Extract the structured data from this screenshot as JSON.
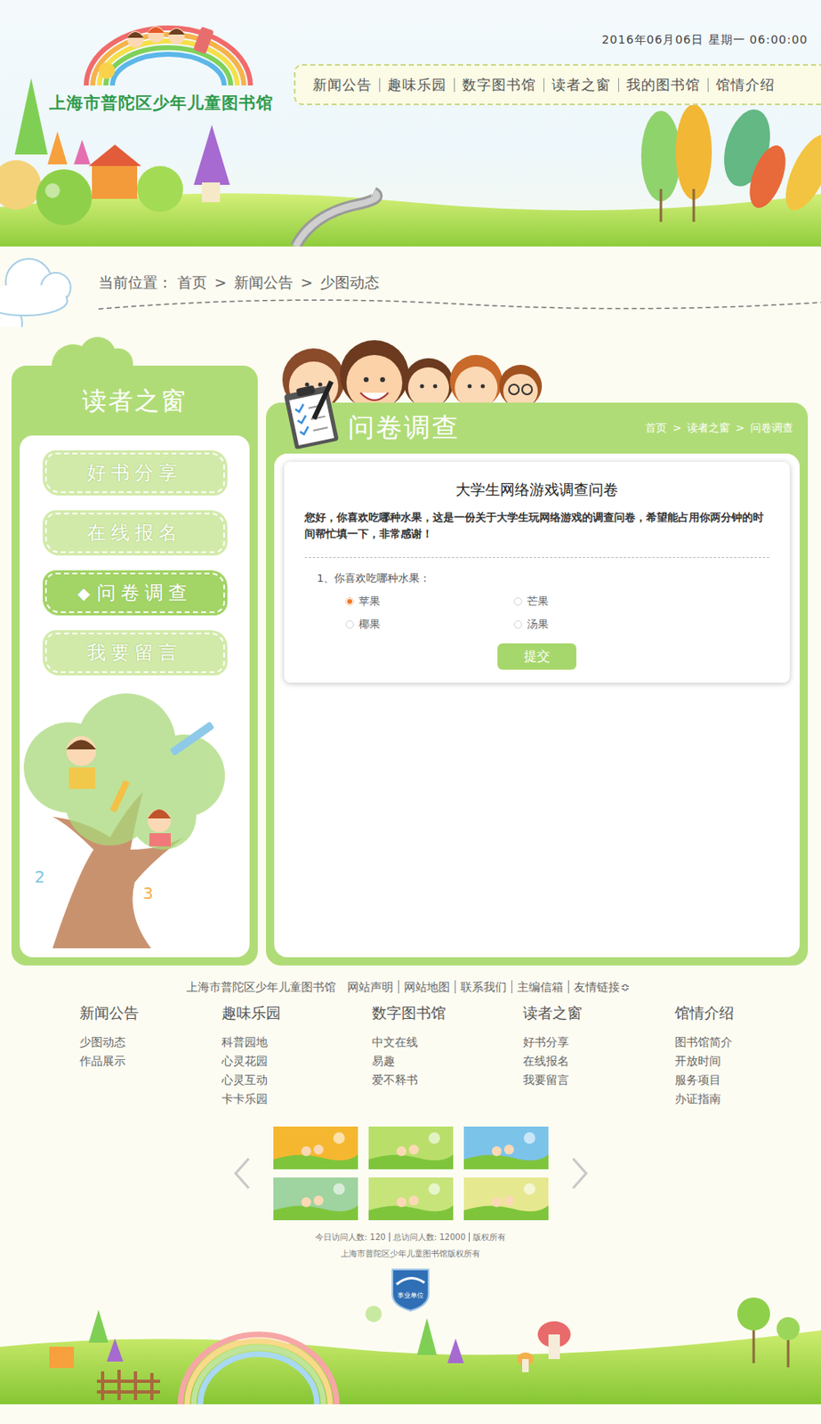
{
  "header": {
    "site_name": "上海市普陀区少年儿童图书馆",
    "datetime": "2016年06月06日 星期一 06:00:00"
  },
  "nav": [
    {
      "label": "新闻公告"
    },
    {
      "label": "趣味乐园"
    },
    {
      "label": "数字图书馆"
    },
    {
      "label": "读者之窗"
    },
    {
      "label": "我的图书馆"
    },
    {
      "label": "馆情介绍"
    }
  ],
  "breadcrumb": {
    "prefix": "当前位置：",
    "separator": ">",
    "items": [
      "首页",
      "新闻公告",
      "少图动态"
    ]
  },
  "sidebar": {
    "title": "读者之窗",
    "marker": "◆",
    "items": [
      {
        "label": "好书分享",
        "selected": false
      },
      {
        "label": "在线报名",
        "selected": false
      },
      {
        "label": "问卷调查",
        "selected": true
      },
      {
        "label": "我要留言",
        "selected": false
      }
    ]
  },
  "panel": {
    "title": "问卷调查",
    "separator": ">",
    "crumbs": [
      "首页",
      "读者之窗",
      "问卷调查"
    ]
  },
  "survey": {
    "title": "大学生网络游戏调查问卷",
    "intro": "您好，你喜欢吃哪种水果，这是一份关于大学生玩网络游戏的调查问卷，希望能占用你两分钟的时间帮忙填一下，非常感谢！",
    "question": "1、你喜欢吃哪种水果：",
    "options": [
      {
        "label": "苹果",
        "selected": true
      },
      {
        "label": "芒果",
        "selected": false
      },
      {
        "label": "椰果",
        "selected": false
      },
      {
        "label": "汤果",
        "selected": false
      }
    ],
    "submit": "提交"
  },
  "footer": {
    "site": "上海市普陀区少年儿童图书馆",
    "links": [
      "网站声明",
      "网站地图",
      "联系我们",
      "主编信箱",
      "友情链接"
    ],
    "dropdown_icon": "≎",
    "columns": [
      {
        "title": "新闻公告",
        "items": [
          "少图动态",
          "作品展示"
        ]
      },
      {
        "title": "趣味乐园",
        "items": [
          "科普园地",
          "心灵花园",
          "心灵互动",
          "卡卡乐园"
        ]
      },
      {
        "title": "数字图书馆",
        "items": [
          "中文在线",
          "易趣",
          "爱不释书"
        ]
      },
      {
        "title": "读者之窗",
        "items": [
          "好书分享",
          "在线报名",
          "我要留言"
        ]
      },
      {
        "title": "馆情介绍",
        "items": [
          "图书馆简介",
          "开放时间",
          "服务项目",
          "办证指南"
        ]
      }
    ],
    "slides": [
      {
        "color": "#f6b730"
      },
      {
        "color": "#b9df6a"
      },
      {
        "color": "#7cc3ea"
      },
      {
        "color": "#9fd3a0"
      },
      {
        "color": "#c6e47a"
      },
      {
        "color": "#e6e890"
      }
    ],
    "stats": [
      "今日访问人数: 120",
      "总访问人数: 12000",
      "版权所有"
    ],
    "copyright": "上海市普陀区少年儿童图书馆版权所有",
    "badge": "事业单位"
  }
}
